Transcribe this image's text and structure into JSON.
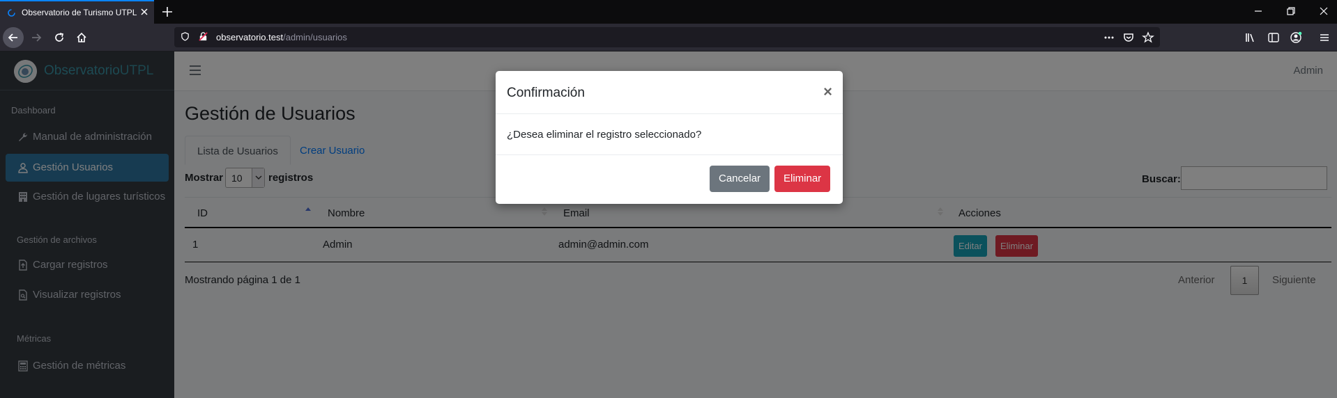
{
  "browser": {
    "tab_title": "Observatorio de Turismo UTPL",
    "url_host": "observatorio.test",
    "url_path": "/admin/usuarios"
  },
  "brand": {
    "name_bold": "Observatorio",
    "name_light": "UTPL",
    "color": "#3a96a8"
  },
  "sidebar": {
    "sections": [
      {
        "header": "Dashboard",
        "items": [
          {
            "label": "Manual de administración",
            "icon": "wrench-icon"
          },
          {
            "label": "Gestión Usuarios",
            "icon": "user-icon",
            "active": true
          },
          {
            "label": "Gestión de lugares turísticos",
            "icon": "building-icon"
          }
        ]
      },
      {
        "header": "Gestión de archivos",
        "items": [
          {
            "label": "Cargar registros",
            "icon": "file-upload-icon"
          },
          {
            "label": "Visualizar registros",
            "icon": "file-view-icon"
          }
        ]
      },
      {
        "header": "Métricas",
        "items": [
          {
            "label": "Gestión de métricas",
            "icon": "calculator-icon"
          }
        ]
      }
    ]
  },
  "topnav": {
    "user": "Admin"
  },
  "page": {
    "title": "Gestión de Usuarios",
    "tabs": [
      "Lista de Usuarios",
      "Crear Usuario"
    ]
  },
  "table_controls": {
    "show_label": "Mostrar",
    "page_size": "10",
    "records_label": "registros",
    "search_label": "Buscar:",
    "search_value": ""
  },
  "table": {
    "columns": [
      "ID",
      "Nombre",
      "Email",
      "Acciones"
    ],
    "rows": [
      {
        "id": "1",
        "name": "Admin",
        "email": "admin@admin.com",
        "edit": "Editar",
        "delete": "Eliminar"
      }
    ]
  },
  "pagination": {
    "info": "Mostrando página 1 de 1",
    "prev": "Anterior",
    "current": "1",
    "next": "Siguiente"
  },
  "modal": {
    "title": "Confirmación",
    "close": "×",
    "message": "¿Desea eliminar el registro seleccionado?",
    "cancel": "Cancelar",
    "confirm": "Eliminar"
  }
}
